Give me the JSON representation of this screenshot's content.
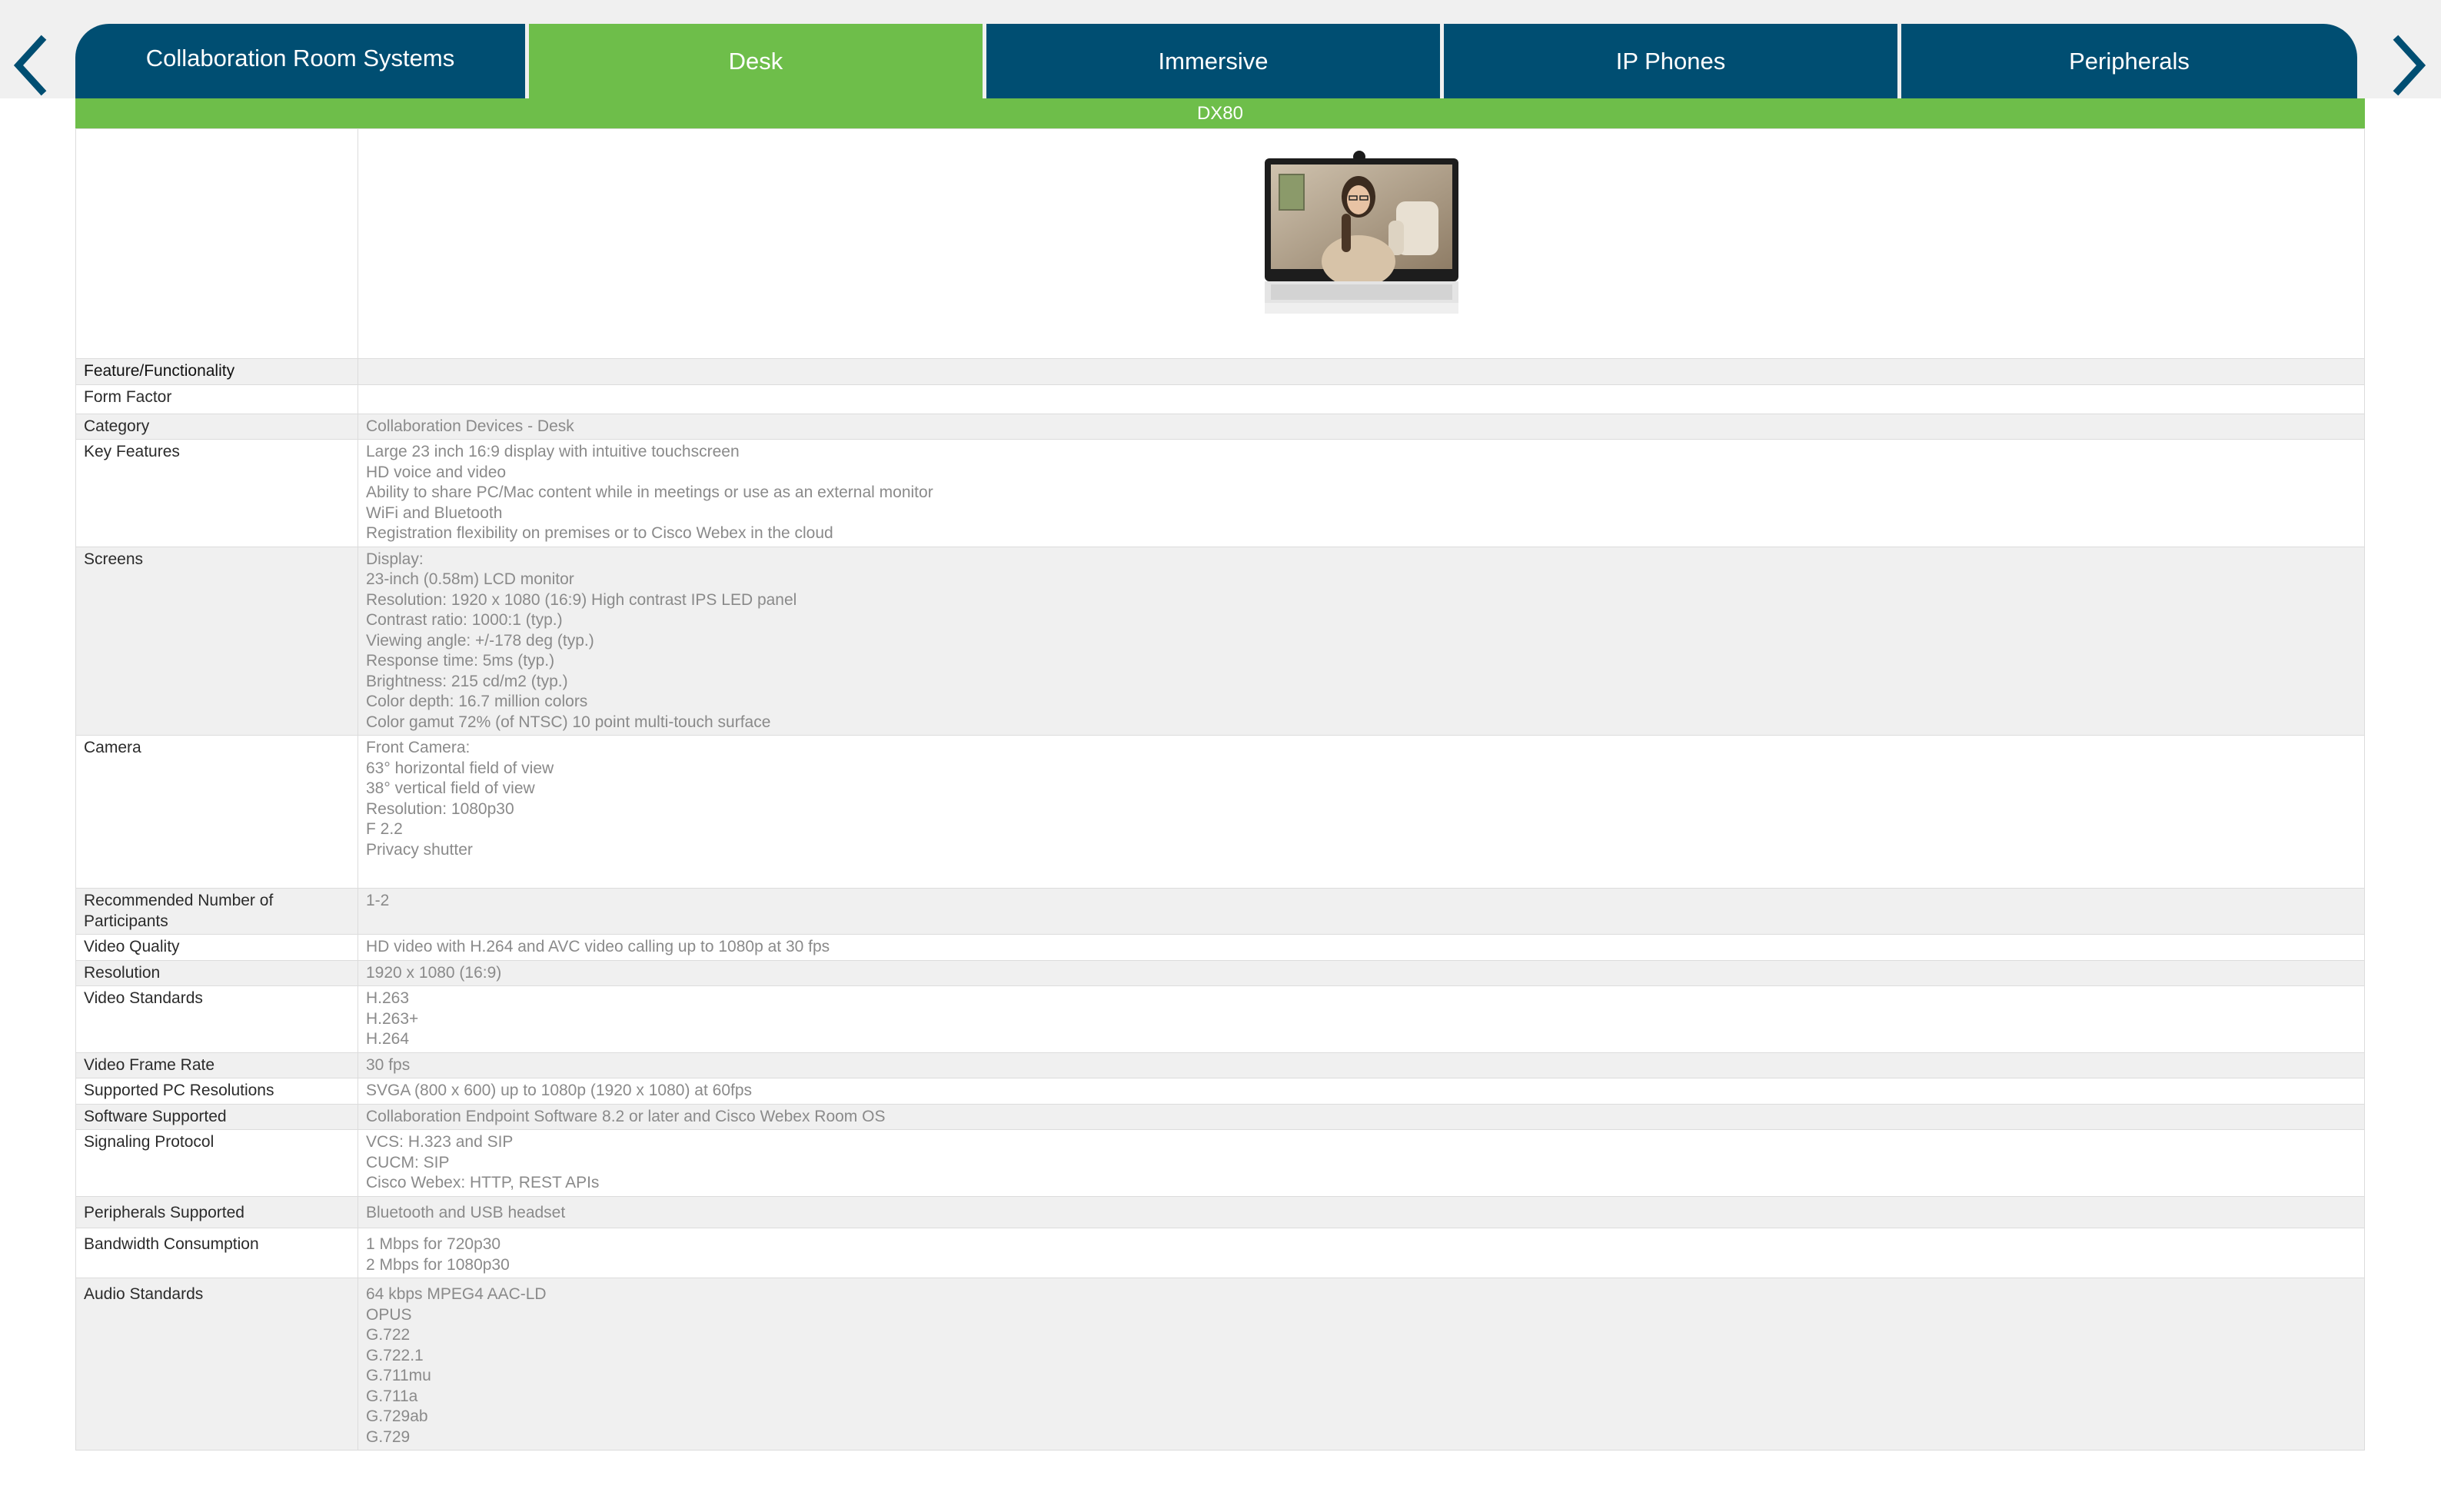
{
  "nav": {
    "tabs": [
      {
        "label": "Collaboration Room Systems",
        "active": false
      },
      {
        "label": "Desk",
        "active": true
      },
      {
        "label": "Immersive",
        "active": false
      },
      {
        "label": "IP Phones",
        "active": false
      },
      {
        "label": "Peripherals",
        "active": false
      }
    ],
    "prev_icon": "chevron-left-icon",
    "next_icon": "chevron-right-icon"
  },
  "product": {
    "name": "DX80"
  },
  "colors": {
    "nav_blue": "#004e72",
    "active_green": "#6ebe4a",
    "row_shade": "#f0f0f0",
    "value_text": "#8a8a8a"
  },
  "specs": {
    "header_label": "Feature/Functionality",
    "form_factor_label": "Form Factor",
    "category": {
      "label": "Category",
      "value": "Collaboration Devices - Desk"
    },
    "key_features": {
      "label": "Key Features",
      "lines": [
        "Large 23 inch 16:9 display with intuitive touchscreen",
        "HD voice and video",
        "Ability to share PC/Mac content while in meetings or use as an external monitor",
        "WiFi and Bluetooth",
        "Registration flexibility on premises or to Cisco Webex in the cloud"
      ]
    },
    "screens": {
      "label": "Screens",
      "lines": [
        "Display:",
        "23-inch (0.58m) LCD monitor",
        "Resolution: 1920 x 1080 (16:9) High contrast IPS LED panel",
        "Contrast ratio: 1000:1 (typ.)",
        "Viewing angle: +/-178 deg (typ.)",
        "Response time: 5ms (typ.)",
        "Brightness: 215 cd/m2 (typ.)",
        "Color depth: 16.7 million colors",
        "Color gamut 72% (of NTSC) 10 point multi-touch surface"
      ]
    },
    "camera": {
      "label": "Camera",
      "lines": [
        "Front Camera:",
        "63° horizontal field of view",
        "38° vertical field of view",
        "Resolution: 1080p30",
        "F 2.2",
        "Privacy shutter"
      ]
    },
    "participants": {
      "label_line1": "Recommended Number of",
      "label_line2": "Participants",
      "value": "1-2"
    },
    "video_quality": {
      "label": "Video Quality",
      "value": "HD video with H.264 and AVC video calling up to 1080p at 30 fps"
    },
    "resolution": {
      "label": "Resolution",
      "value": "1920 x 1080 (16:9)"
    },
    "video_standards": {
      "label": "Video Standards",
      "lines": [
        "H.263",
        "H.263+",
        "H.264"
      ]
    },
    "frame_rate": {
      "label": "Video Frame Rate",
      "value": "30 fps"
    },
    "pc_resolutions": {
      "label": "Supported PC Resolutions",
      "value": "SVGA (800 x 600) up to 1080p (1920 x 1080) at 60fps"
    },
    "software": {
      "label": "Software Supported",
      "value": "Collaboration Endpoint Software 8.2 or later and Cisco Webex Room OS"
    },
    "signaling": {
      "label": "Signaling Protocol",
      "lines": [
        "VCS: H.323 and SIP",
        "CUCM: SIP",
        "Cisco Webex: HTTP, REST APIs"
      ]
    },
    "peripherals": {
      "label": "Peripherals Supported",
      "value": "Bluetooth and USB headset"
    },
    "bandwidth": {
      "label": "Bandwidth Consumption",
      "lines": [
        "1 Mbps for 720p30",
        "2 Mbps for 1080p30"
      ]
    },
    "audio": {
      "label": "Audio Standards",
      "lines": [
        "64 kbps MPEG4 AAC-LD",
        "OPUS",
        "G.722",
        "G.722.1",
        "G.711mu",
        "G.711a",
        "G.729ab",
        "G.729"
      ]
    }
  }
}
